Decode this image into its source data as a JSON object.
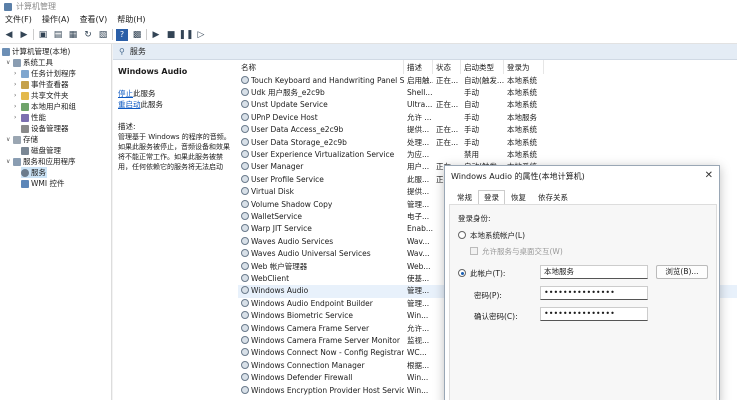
{
  "window": {
    "title": "计算机管理"
  },
  "menu": [
    "文件(F)",
    "操作(A)",
    "查看(V)",
    "帮助(H)"
  ],
  "tree": {
    "root": "计算机管理(本地)",
    "items": [
      "系统工具",
      "任务计划程序",
      "事件查看器",
      "共享文件夹",
      "本地用户和组",
      "性能",
      "设备管理器",
      "存储",
      "磁盘管理",
      "服务和应用程序",
      "服务",
      "WMI 控件"
    ]
  },
  "center": {
    "header": "服务",
    "service_name": "Windows Audio",
    "stop_link": "停止",
    "stop_suffix": "此服务",
    "restart_link": "重启动",
    "restart_suffix": "此服务",
    "desc_label": "描述:",
    "desc_lines": [
      "管理基于 Windows 的程序的音频。",
      "如果此服务被停止，音频设备和效果",
      "将不能正常工作。如果此服务被禁",
      "用，任何依赖它的服务将无法启动"
    ]
  },
  "columns": [
    "名称",
    "描述",
    "状态",
    "启动类型",
    "登录为"
  ],
  "services": [
    [
      "Touch Keyboard and Handwriting Panel Servi...",
      "启用触...",
      "正在...",
      "自动(触发...",
      "本地系统"
    ],
    [
      "Udk 用户服务_e2c9b",
      "Shell...",
      "",
      "手动",
      "本地系统"
    ],
    [
      "Unst Update Service",
      "Ultra...",
      "正在...",
      "自动",
      "本地系统"
    ],
    [
      "UPnP Device Host",
      "允许 ...",
      "",
      "手动",
      "本地服务"
    ],
    [
      "User Data Access_e2c9b",
      "提供...",
      "正在...",
      "手动",
      "本地系统"
    ],
    [
      "User Data Storage_e2c9b",
      "处理...",
      "正在...",
      "手动",
      "本地系统"
    ],
    [
      "User Experience Virtualization Service",
      "为应...",
      "",
      "禁用",
      "本地系统"
    ],
    [
      "User Manager",
      "用户...",
      "正在...",
      "自动(触发...",
      "本地系统"
    ],
    [
      "User Profile Service",
      "此服...",
      "正在...",
      "自动",
      "本地系统"
    ],
    [
      "Virtual Disk",
      "提供...",
      "",
      "",
      ""
    ],
    [
      "Volume Shadow Copy",
      "管理...",
      "",
      "",
      ""
    ],
    [
      "WalletService",
      "电子...",
      "",
      "",
      ""
    ],
    [
      "Warp JIT Service",
      "Enab...",
      "",
      "",
      ""
    ],
    [
      "Waves Audio Services",
      "Wav...",
      "",
      "",
      ""
    ],
    [
      "Waves Audio Universal Services",
      "Wav...",
      "",
      "",
      ""
    ],
    [
      "Web 帐户管理器",
      "Web...",
      "",
      "",
      ""
    ],
    [
      "WebClient",
      "使基...",
      "",
      "",
      ""
    ],
    [
      "Windows Audio",
      "管理...",
      "",
      "",
      ""
    ],
    [
      "Windows Audio Endpoint Builder",
      "管理...",
      "",
      "",
      ""
    ],
    [
      "Windows Biometric Service",
      "Win...",
      "",
      "",
      ""
    ],
    [
      "Windows Camera Frame Server",
      "允许...",
      "",
      "",
      ""
    ],
    [
      "Windows Camera Frame Server Monitor",
      "监视...",
      "",
      "",
      ""
    ],
    [
      "Windows Connect Now - Config Registrar",
      "WC...",
      "",
      "",
      ""
    ],
    [
      "Windows Connection Manager",
      "根据...",
      "",
      "",
      ""
    ],
    [
      "Windows Defender Firewall",
      "Win...",
      "",
      "",
      ""
    ],
    [
      "Windows Encryption Provider Host Service",
      "Win...",
      "",
      "",
      ""
    ]
  ],
  "dialog": {
    "title": "Windows Audio 的属性(本地计算机)",
    "close": "✕",
    "tabs": [
      "常规",
      "登录",
      "恢复",
      "依存关系"
    ],
    "logon_label": "登录身份:",
    "local_system": "本地系统帐户(L)",
    "allow_desktop": "允许服务与桌面交互(W)",
    "this_account": "此帐户(T):",
    "account_value": "本地服务",
    "browse": "浏览(B)...",
    "password_label": "密码(P):",
    "password_value": "•••••••••••••••",
    "confirm_label": "确认密码(C):",
    "confirm_value": "•••••••••••••••"
  }
}
